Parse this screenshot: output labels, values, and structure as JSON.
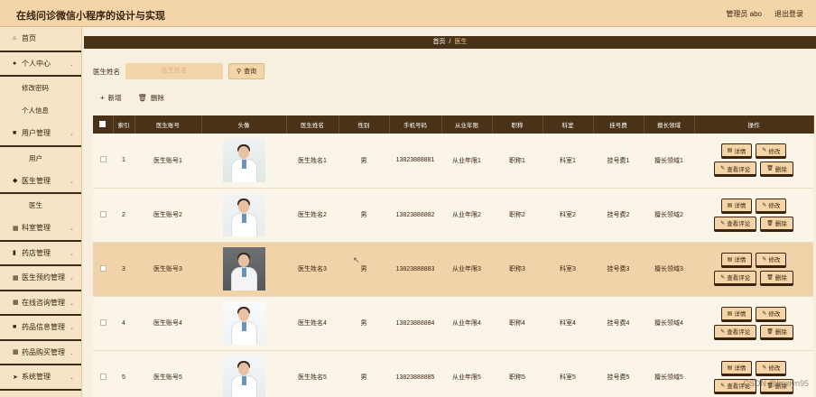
{
  "app": {
    "title": "在线问诊微信小程序的设计与实现",
    "admin": "管理员 abo",
    "logout": "退出登录"
  },
  "sidebar": {
    "items": [
      {
        "label": "首页",
        "icon": "home-icon",
        "glyph": "⌂"
      },
      {
        "label": "个人中心",
        "icon": "user-icon",
        "glyph": "●",
        "subs": [
          "修改密码",
          "个人信息"
        ]
      },
      {
        "label": "用户管理",
        "icon": "folder-icon",
        "glyph": "■",
        "subs": [
          "用户"
        ]
      },
      {
        "label": "医生管理",
        "icon": "doctor-icon",
        "glyph": "◆",
        "subs": [
          "医生"
        ]
      },
      {
        "label": "科室管理",
        "icon": "grid-icon",
        "glyph": "▦"
      },
      {
        "label": "药店管理",
        "icon": "chart-icon",
        "glyph": "▮"
      },
      {
        "label": "医生预约管理",
        "icon": "grid-icon",
        "glyph": "▦"
      },
      {
        "label": "在线咨询管理",
        "icon": "grid-icon",
        "glyph": "▦"
      },
      {
        "label": "药品信息管理",
        "icon": "doc-icon",
        "glyph": "■"
      },
      {
        "label": "药品购买管理",
        "icon": "grid-icon",
        "glyph": "▦"
      },
      {
        "label": "系统管理",
        "icon": "send-icon",
        "glyph": "➤"
      }
    ]
  },
  "breadcrumb": {
    "home": "首页",
    "sep": "/",
    "current": "医生"
  },
  "search": {
    "label": "医生姓名",
    "placeholder": "医生姓名",
    "button": "查询"
  },
  "actions": {
    "add": "新增",
    "delete": "删除"
  },
  "table": {
    "headers": [
      "",
      "索引",
      "医生账号",
      "头像",
      "医生姓名",
      "性别",
      "手机号码",
      "从业年限",
      "职称",
      "科室",
      "挂号费",
      "擅长领域",
      "操作"
    ],
    "rows": [
      {
        "index": "1",
        "account": "医生账号1",
        "name": "医生姓名1",
        "gender": "男",
        "phone": "13823888881",
        "years": "从业年限1",
        "title": "职称1",
        "dept": "科室1",
        "fee": "挂号费1",
        "field": "擅长领域1"
      },
      {
        "index": "2",
        "account": "医生账号2",
        "name": "医生姓名2",
        "gender": "男",
        "phone": "13823888882",
        "years": "从业年限2",
        "title": "职称2",
        "dept": "科室2",
        "fee": "挂号费2",
        "field": "擅长领域2"
      },
      {
        "index": "3",
        "account": "医生账号3",
        "name": "医生姓名3",
        "gender": "男",
        "phone": "13823888883",
        "years": "从业年限3",
        "title": "职称3",
        "dept": "科室3",
        "fee": "挂号费3",
        "field": "擅长领域3"
      },
      {
        "index": "4",
        "account": "医生账号4",
        "name": "医生姓名4",
        "gender": "男",
        "phone": "13823888884",
        "years": "从业年限4",
        "title": "职称4",
        "dept": "科室4",
        "fee": "挂号费4",
        "field": "擅长领域4"
      },
      {
        "index": "5",
        "account": "医生账号5",
        "name": "医生姓名5",
        "gender": "男",
        "phone": "13823888885",
        "years": "从业年限5",
        "title": "职称5",
        "dept": "科室5",
        "fee": "挂号费5",
        "field": "擅长领域5"
      }
    ],
    "ops": {
      "detail": "详情",
      "edit": "修改",
      "review": "查看评论",
      "delete": "删除"
    }
  },
  "watermark": "CSDN @lmxiyn95"
}
